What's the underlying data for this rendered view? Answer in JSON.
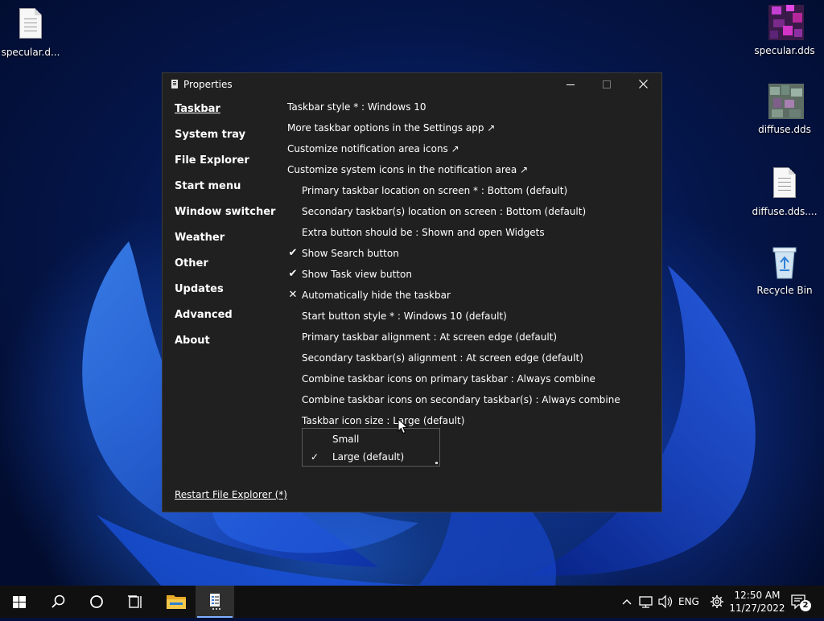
{
  "desktop": {
    "icons_left": [
      {
        "label": "specular.d...",
        "kind": "file"
      }
    ],
    "icons_right": [
      {
        "label": "specular.dds",
        "kind": "dds-magenta"
      },
      {
        "label": "diffuse.dds",
        "kind": "dds-green"
      },
      {
        "label": "diffuse.dds....",
        "kind": "file"
      },
      {
        "label": "Recycle Bin",
        "kind": "recycle-bin"
      }
    ]
  },
  "window": {
    "title": "Properties",
    "nav": [
      {
        "label": "Taskbar",
        "active": true
      },
      {
        "label": "System tray",
        "active": false
      },
      {
        "label": "File Explorer",
        "active": false
      },
      {
        "label": "Start menu",
        "active": false
      },
      {
        "label": "Window switcher",
        "active": false
      },
      {
        "label": "Weather",
        "active": false
      },
      {
        "label": "Other",
        "active": false
      },
      {
        "label": "Updates",
        "active": false
      },
      {
        "label": "Advanced",
        "active": false
      },
      {
        "label": "About",
        "active": false
      }
    ],
    "restart_link": "Restart File Explorer (*)",
    "settings": [
      {
        "label": "Taskbar style * : Windows 10",
        "indent": false,
        "mark": ""
      },
      {
        "label": "More taskbar options in the Settings app ↗",
        "indent": false,
        "mark": ""
      },
      {
        "label": "Customize notification area icons ↗",
        "indent": false,
        "mark": ""
      },
      {
        "label": "Customize system icons in the notification area ↗",
        "indent": false,
        "mark": ""
      },
      {
        "label": "Primary taskbar location on screen * : Bottom (default)",
        "indent": true,
        "mark": ""
      },
      {
        "label": "Secondary taskbar(s) location on screen : Bottom (default)",
        "indent": true,
        "mark": ""
      },
      {
        "label": "Extra button should be : Shown and open Widgets",
        "indent": true,
        "mark": ""
      },
      {
        "label": "Show Search button",
        "indent": true,
        "mark": "✔"
      },
      {
        "label": "Show Task view button",
        "indent": true,
        "mark": "✔"
      },
      {
        "label": "Automatically hide the taskbar",
        "indent": true,
        "mark": "✕"
      },
      {
        "label": "Start button style * : Windows 10 (default)",
        "indent": true,
        "mark": ""
      },
      {
        "label": "Primary taskbar alignment : At screen edge (default)",
        "indent": true,
        "mark": ""
      },
      {
        "label": "Secondary taskbar(s) alignment : At screen edge (default)",
        "indent": true,
        "mark": ""
      },
      {
        "label": "Combine taskbar icons on primary taskbar : Always combine",
        "indent": true,
        "mark": ""
      },
      {
        "label": "Combine taskbar icons on secondary taskbar(s) : Always combine",
        "indent": true,
        "mark": ""
      },
      {
        "label": "Taskbar icon size : Large (default)",
        "indent": true,
        "mark": ""
      }
    ],
    "dropdown": {
      "items": [
        {
          "label": "Small",
          "checked": false
        },
        {
          "label": "Large (default)",
          "checked": true
        }
      ],
      "check_glyph": "✓"
    }
  },
  "taskbar": {
    "language": "ENG",
    "time": "12:50 AM",
    "date": "11/27/2022",
    "notification_count": "2"
  }
}
